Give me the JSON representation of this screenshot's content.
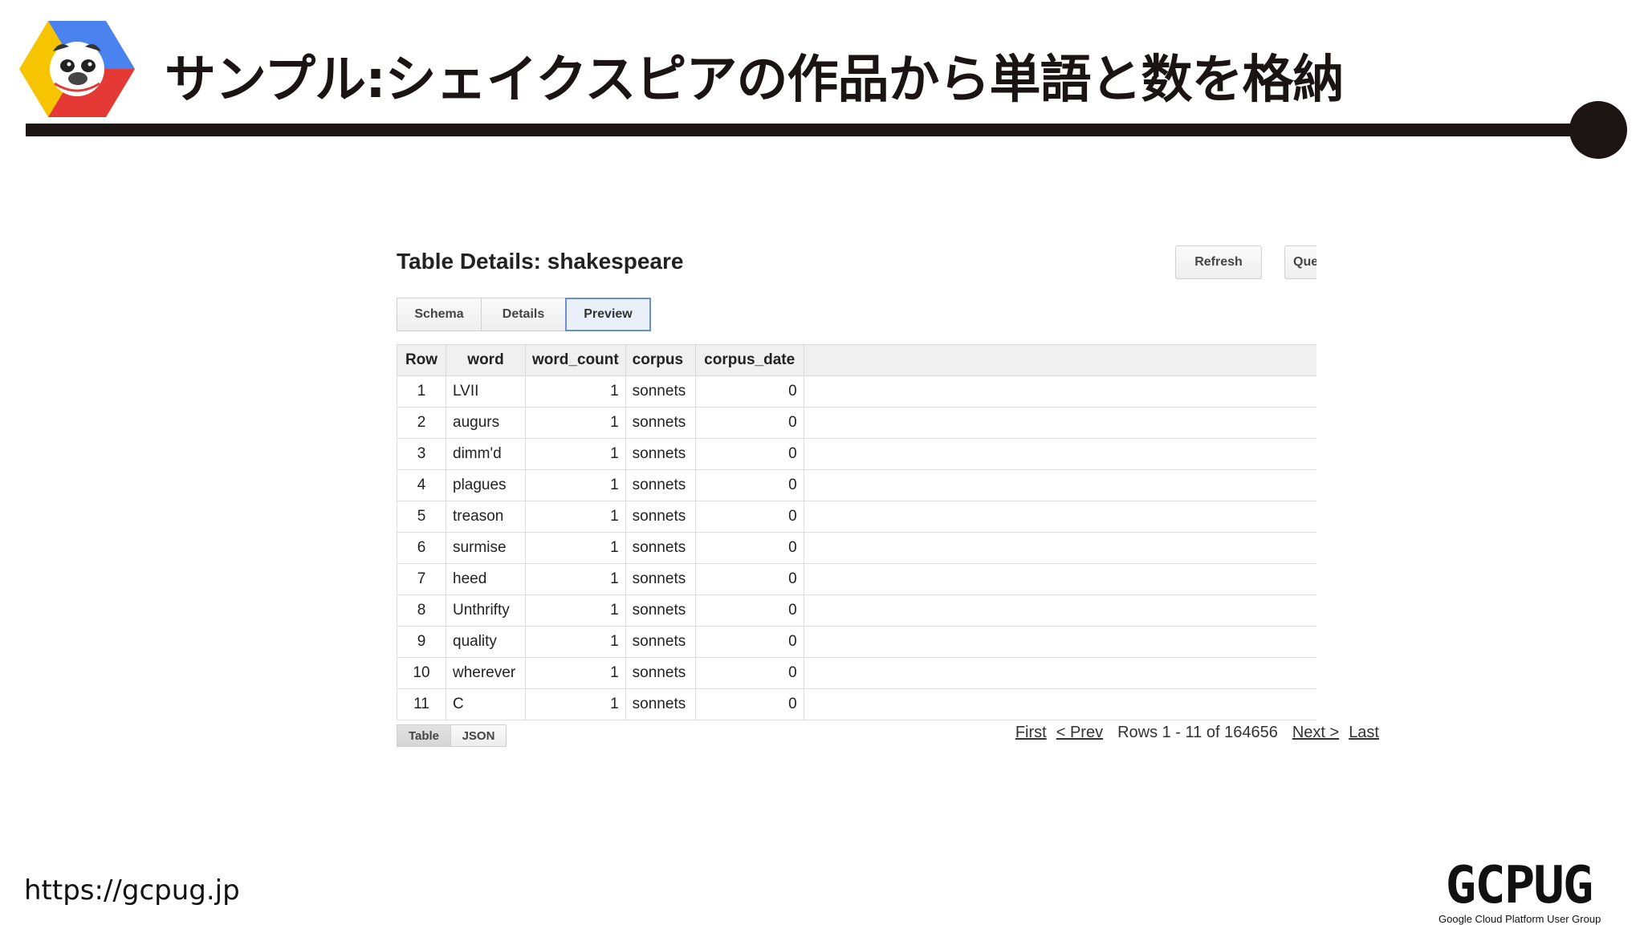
{
  "slide": {
    "title": "サンプル:シェイクスピアの作品から単語と数を格納",
    "footer_url": "https://gcpug.jp",
    "brand_name": "GCPUG",
    "brand_tagline": "Google Cloud Platform User Group",
    "colors": {
      "rule": "#1d1414",
      "logo_blue": "#4a83f0",
      "logo_red": "#e53935",
      "logo_yellow": "#f6c400"
    }
  },
  "panel": {
    "heading": "Table Details: shakespeare",
    "buttons": {
      "refresh": "Refresh",
      "query": "Que"
    },
    "tabs": [
      {
        "label": "Schema",
        "active": false
      },
      {
        "label": "Details",
        "active": false
      },
      {
        "label": "Preview",
        "active": true
      }
    ],
    "columns": [
      "Row",
      "word",
      "word_count",
      "corpus",
      "corpus_date"
    ],
    "rows": [
      {
        "row": "1",
        "word": "LVII",
        "word_count": "1",
        "corpus": "sonnets",
        "corpus_date": "0"
      },
      {
        "row": "2",
        "word": "augurs",
        "word_count": "1",
        "corpus": "sonnets",
        "corpus_date": "0"
      },
      {
        "row": "3",
        "word": "dimm'd",
        "word_count": "1",
        "corpus": "sonnets",
        "corpus_date": "0"
      },
      {
        "row": "4",
        "word": "plagues",
        "word_count": "1",
        "corpus": "sonnets",
        "corpus_date": "0"
      },
      {
        "row": "5",
        "word": "treason",
        "word_count": "1",
        "corpus": "sonnets",
        "corpus_date": "0"
      },
      {
        "row": "6",
        "word": "surmise",
        "word_count": "1",
        "corpus": "sonnets",
        "corpus_date": "0"
      },
      {
        "row": "7",
        "word": "heed",
        "word_count": "1",
        "corpus": "sonnets",
        "corpus_date": "0"
      },
      {
        "row": "8",
        "word": "Unthrifty",
        "word_count": "1",
        "corpus": "sonnets",
        "corpus_date": "0"
      },
      {
        "row": "9",
        "word": "quality",
        "word_count": "1",
        "corpus": "sonnets",
        "corpus_date": "0"
      },
      {
        "row": "10",
        "word": "wherever",
        "word_count": "1",
        "corpus": "sonnets",
        "corpus_date": "0"
      },
      {
        "row": "11",
        "word": "C",
        "word_count": "1",
        "corpus": "sonnets",
        "corpus_date": "0"
      }
    ],
    "view_toggle": [
      "Table",
      "JSON"
    ],
    "pager": {
      "first": "First",
      "prev": "< Prev",
      "info": "Rows 1 - 11 of 164656",
      "next": "Next >",
      "last": "Last"
    }
  }
}
